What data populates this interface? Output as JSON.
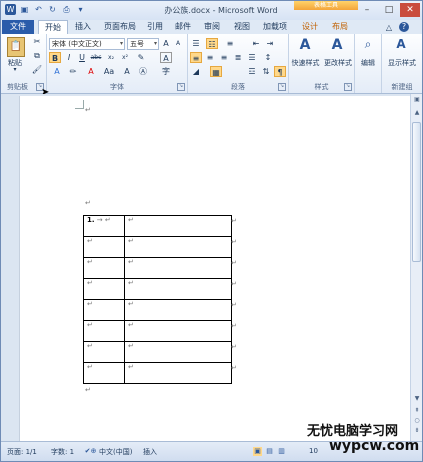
{
  "window": {
    "title": "办公族.docx - Microsoft Word",
    "context_tab_group": "表格工具",
    "controls": {
      "minimize": "–",
      "maximize": "□",
      "close": "✕"
    }
  },
  "qat": {
    "save_icon": "save-icon",
    "undo_icon": "undo-icon",
    "redo_icon": "redo-icon",
    "print_icon": "print-icon",
    "customize_icon": "chevron-down-icon"
  },
  "tabs": {
    "file": "文件",
    "items": [
      "开始",
      "插入",
      "页面布局",
      "引用",
      "邮件",
      "审阅",
      "视图",
      "加载项",
      "设计",
      "布局"
    ],
    "active_index": 0
  },
  "ribbon": {
    "clipboard": {
      "paste_label": "粘贴",
      "label": "剪贴板"
    },
    "font": {
      "font_name": "宋体 (中文正文)",
      "font_size": "五号",
      "label": "字体"
    },
    "paragraph": {
      "label": "段落"
    },
    "styles": {
      "quick_styles_label": "快速样式",
      "change_styles_label": "更改样式",
      "label": "样式"
    },
    "editing": {
      "edit_label": "编辑",
      "label": ""
    },
    "new_group": {
      "show_styles_label": "显示样式",
      "label": "新建组"
    }
  },
  "document": {
    "table": {
      "first_cell_text": "1.",
      "rows": 8
    }
  },
  "statusbar": {
    "page": "页面: 1/1",
    "words": "字数: 1",
    "language": "中文(中国)",
    "mode": "插入",
    "zoom": "10"
  },
  "watermark": {
    "line1": "无忧电脑学习网",
    "line2": "wypcw.com"
  },
  "colors": {
    "file_tab": "#2a5caa",
    "context_tab": "#f3a53a",
    "ribbon_bg": "#e4ecf7",
    "highlight": "#ffd88a"
  }
}
